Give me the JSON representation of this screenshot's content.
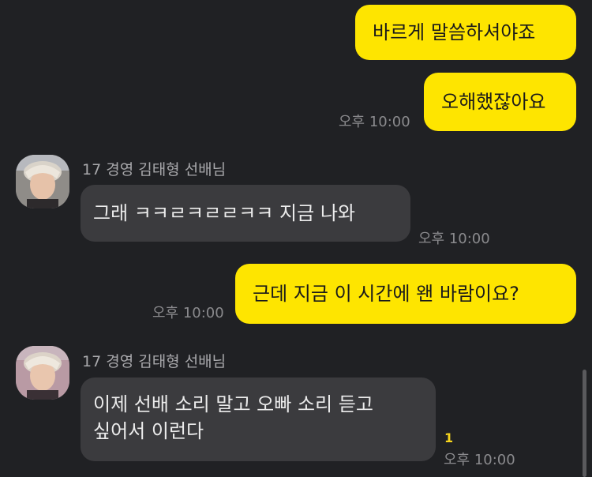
{
  "messages": {
    "m1": {
      "text": "바르게 말씀하셔야죠"
    },
    "m2": {
      "text": "오해했잖아요",
      "time": "오후 10:00"
    },
    "m3": {
      "sender": "17 경영 김태형 선배님",
      "text": "그래 ㅋㅋㄹㅋㄹㄹㅋㅋ 지금 나와",
      "time": "오후 10:00"
    },
    "m4": {
      "text": "근데 지금 이 시간에 왠 바람이요?",
      "time": "오후 10:00"
    },
    "m5": {
      "sender": "17 경영 김태형 선배님",
      "text_line1": "이제 선배 소리 말고 오빠 소리 듣고",
      "text_line2": "싶어서 이런다",
      "time": "오후 10:00",
      "unread": "1"
    }
  },
  "colors": {
    "background": "#202124",
    "outgoing_bubble": "#fee500",
    "incoming_bubble": "#3b3b3e"
  },
  "icons": {
    "avatar": "profile-photo-avatar"
  }
}
